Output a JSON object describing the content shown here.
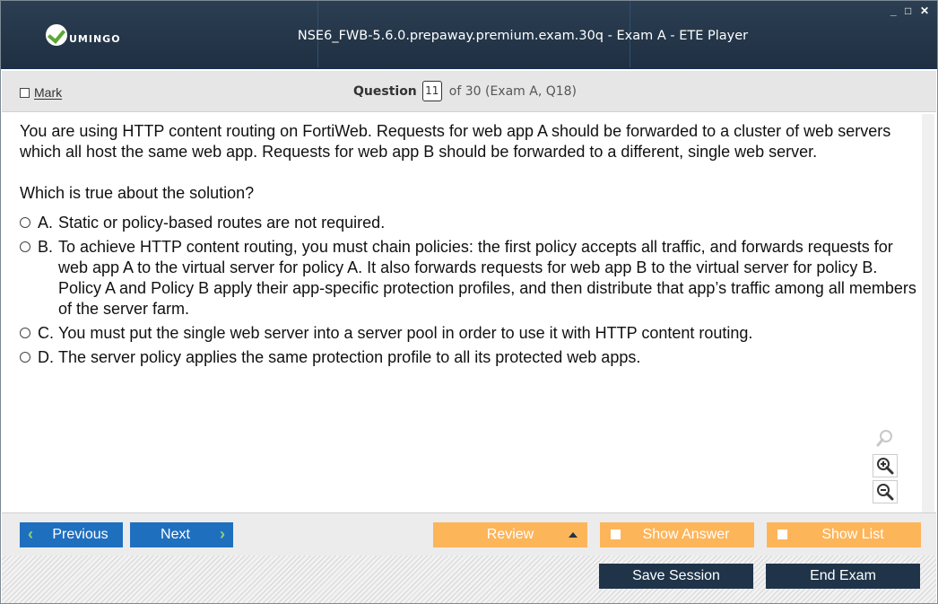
{
  "window": {
    "title": "NSE6_FWB-5.6.0.prepaway.premium.exam.30q - Exam A - ETE Player",
    "logo_text": "UMINGO",
    "controls": [
      "_",
      "□",
      "✕"
    ]
  },
  "header": {
    "mark_label": "Mark",
    "question_label": "Question",
    "question_number": "11",
    "of_text": "of 30 (Exam A, Q18)"
  },
  "question": {
    "text": "You are using HTTP content routing on FortiWeb. Requests for web app A should be forwarded to a cluster of web servers which all host the same web app. Requests for web app B should be forwarded to a different, single web server.",
    "prompt": "Which is true about the solution?",
    "options": [
      {
        "letter": "A.",
        "text": "Static or policy-based routes are not required."
      },
      {
        "letter": "B.",
        "text": "To achieve HTTP content routing, you must chain policies: the first policy accepts all traffic, and forwards requests for web app A to the virtual server for policy A. It also forwards requests for web app B to the virtual server for policy B. Policy A and Policy B apply their app-specific protection profiles, and then distribute that app’s traffic among all members of the server farm."
      },
      {
        "letter": "C.",
        "text": "You must put the single web server into a server pool in order to use it with HTTP content routing."
      },
      {
        "letter": "D.",
        "text": "The server policy applies the same protection profile to all its protected web apps."
      }
    ]
  },
  "nav": {
    "previous": "Previous",
    "next": "Next",
    "review": "Review",
    "show_answer": "Show Answer",
    "show_list": "Show List"
  },
  "footer": {
    "save_session": "Save Session",
    "end_exam": "End Exam"
  },
  "colors": {
    "titlebar": "#1f3043",
    "nav_blue": "#1f6fbf",
    "nav_orange": "#fdb55a",
    "footer_dark": "#1f3449",
    "chevron_green": "#8fd36e"
  }
}
